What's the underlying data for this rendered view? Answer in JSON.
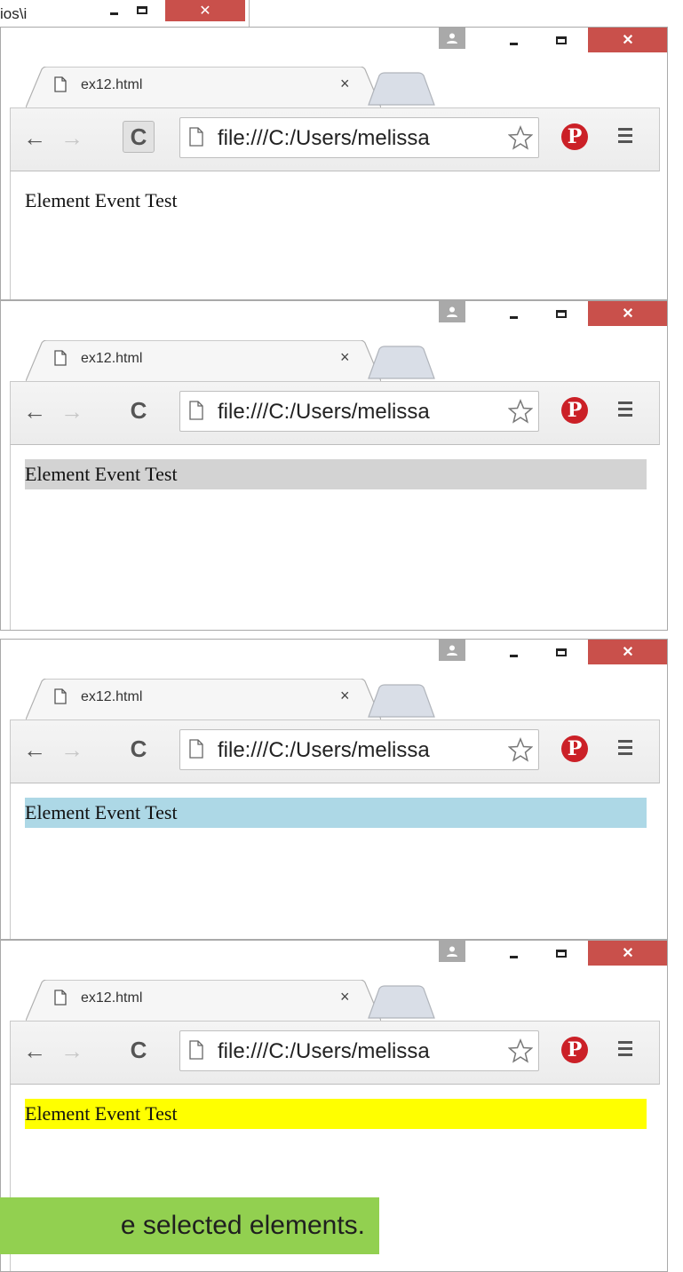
{
  "background_window": {
    "path_fragment": "ios\\i",
    "close_glyph": "✕"
  },
  "windows": [
    {
      "tab_title": "ex12.html",
      "tab_close": "×",
      "url": "file:///C:/Users/melissa",
      "content_text": "Element Event Test",
      "highlight_color": "#ffffff",
      "reload_pressed": true
    },
    {
      "tab_title": "ex12.html",
      "tab_close": "×",
      "url": "file:///C:/Users/melissa",
      "content_text": "Element Event Test",
      "highlight_color": "#d3d3d3",
      "reload_pressed": false
    },
    {
      "tab_title": "ex12.html",
      "tab_close": "×",
      "url": "file:///C:/Users/melissa",
      "content_text": "Element Event Test",
      "highlight_color": "#add8e6",
      "reload_pressed": false
    },
    {
      "tab_title": "ex12.html",
      "tab_close": "×",
      "url": "file:///C:/Users/melissa",
      "content_text": "Element Event Test",
      "highlight_color": "#ffff00",
      "reload_pressed": false
    }
  ],
  "window_controls": {
    "close_glyph": "✕"
  },
  "toolbar_icons": {
    "back": "back-arrow-icon",
    "forward": "forward-arrow-icon",
    "reload": "reload-icon",
    "star": "star-icon",
    "pinterest": "pinterest-icon",
    "menu": "hamburger-menu-icon",
    "pinterest_glyph": "P"
  },
  "callout": {
    "text": "e selected elements."
  },
  "colors": {
    "close_red": "#c9504b",
    "callout_green": "#92d050",
    "pinterest_red": "#cb2027"
  }
}
